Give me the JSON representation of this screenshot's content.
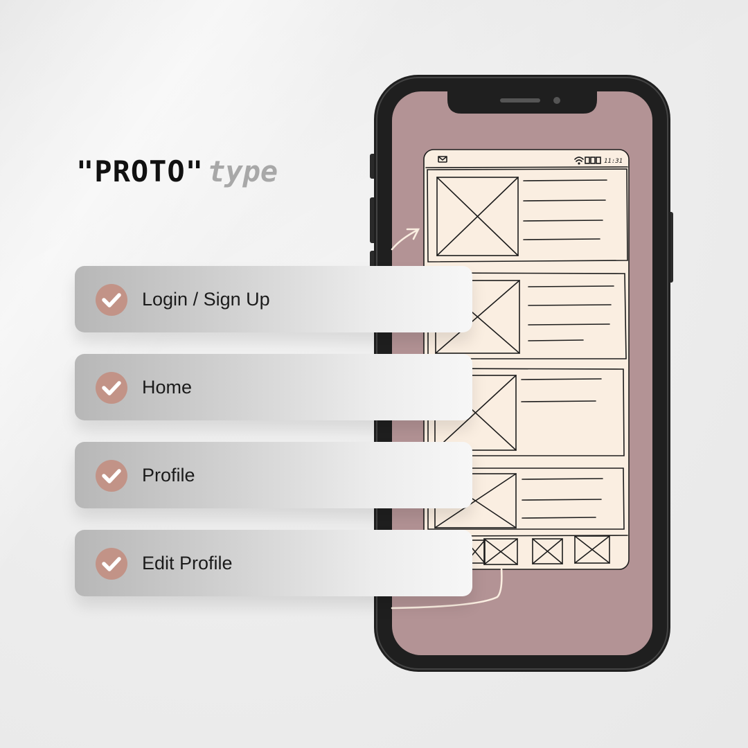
{
  "heading": {
    "quoted": "\"PROTO\"",
    "suffix": "type"
  },
  "checklist": {
    "items": [
      {
        "label": "Login / Sign Up",
        "icon": "checkmark-icon"
      },
      {
        "label": "Home",
        "icon": "checkmark-icon"
      },
      {
        "label": "Profile",
        "icon": "checkmark-icon"
      },
      {
        "label": "Edit Profile",
        "icon": "checkmark-icon"
      }
    ]
  },
  "phone": {
    "status_time": "11:31",
    "icons": [
      "mail-icon",
      "wifi-icon",
      "battery-icon"
    ]
  },
  "colors": {
    "screen": "#b39395",
    "wireframe_paper": "#faeee1",
    "check_circle": "#c29387",
    "phone_body": "#202020"
  }
}
